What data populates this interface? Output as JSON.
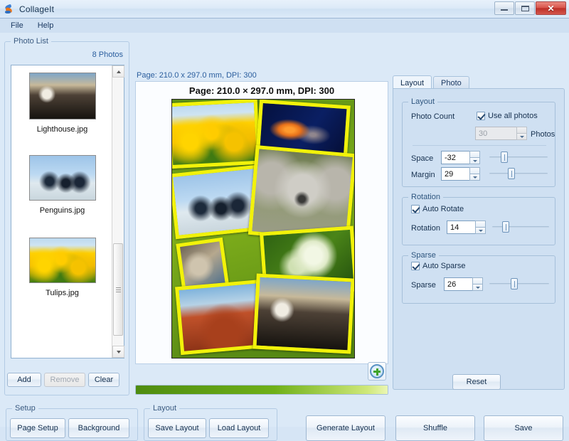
{
  "window": {
    "title": "CollageIt",
    "icon": "app-logo-icon",
    "minimize_label": "",
    "maximize_label": "",
    "close_label": "✕"
  },
  "menu": {
    "items": [
      {
        "label": "File"
      },
      {
        "label": "Help"
      }
    ]
  },
  "photo_list": {
    "legend": "Photo List",
    "count_label": "8 Photos",
    "items": [
      {
        "name": "Lighthouse.jpg",
        "art": "art-lighthouse"
      },
      {
        "name": "Penguins.jpg",
        "art": "art-penguins"
      },
      {
        "name": "Tulips.jpg",
        "art": "art-tulips"
      }
    ],
    "buttons": {
      "add": "Add",
      "remove": "Remove",
      "clear": "Clear"
    }
  },
  "preview": {
    "page_info": "Page: 210.0 x 297.0 mm, DPI: 300",
    "title": "Page: 210.0 × 297.0 mm, DPI: 300",
    "background_color": "#6fa018",
    "photo_border_color": "#f2f20a",
    "zoom_add_icon": "plus-circle-icon",
    "progress_percent": 100
  },
  "right_panel": {
    "tabs": [
      {
        "label": "Layout",
        "active": true
      },
      {
        "label": "Photo",
        "active": false
      }
    ],
    "layout_group": {
      "legend": "Layout",
      "photo_count_label": "Photo Count",
      "use_all_photos_label": "Use all photos",
      "use_all_photos_checked": true,
      "photo_count_value": "30",
      "photos_suffix": "Photos",
      "space_label": "Space",
      "space_value": "-32",
      "margin_label": "Margin",
      "margin_value": "29"
    },
    "rotation_group": {
      "legend": "Rotation",
      "auto_rotate_label": "Auto Rotate",
      "auto_rotate_checked": true,
      "rotation_label": "Rotation",
      "rotation_value": "14"
    },
    "sparse_group": {
      "legend": "Sparse",
      "auto_sparse_label": "Auto Sparse",
      "auto_sparse_checked": true,
      "sparse_label": "Sparse",
      "sparse_value": "26"
    },
    "reset_label": "Reset"
  },
  "bottom": {
    "setup_group": {
      "legend": "Setup",
      "page_setup": "Page Setup",
      "background": "Background"
    },
    "layout_group": {
      "legend": "Layout",
      "save_layout": "Save Layout",
      "load_layout": "Load Layout"
    },
    "generate_layout": "Generate Layout",
    "shuffle": "Shuffle",
    "save": "Save"
  }
}
